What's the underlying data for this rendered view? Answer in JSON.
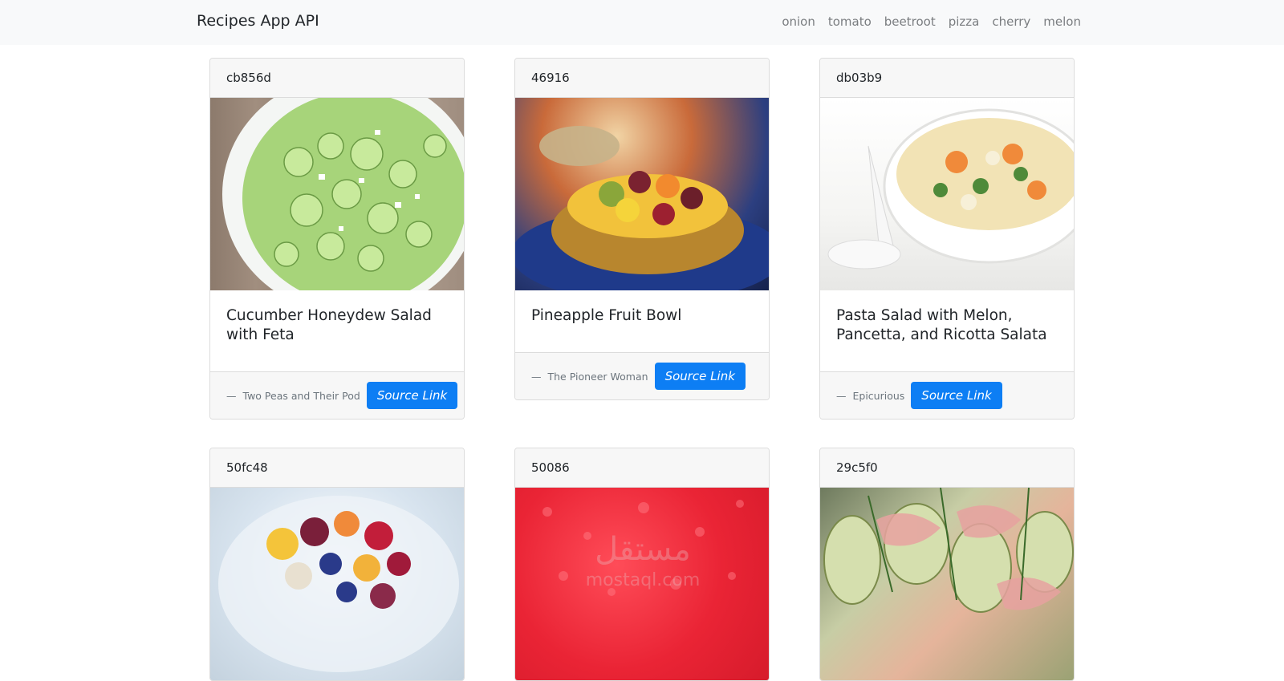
{
  "navbar": {
    "brand": "Recipes App API",
    "links": [
      "onion",
      "tomato",
      "beetroot",
      "pizza",
      "cherry",
      "melon"
    ]
  },
  "cards": [
    {
      "id": "cb856d",
      "title": "Cucumber Honeydew Salad with Feta",
      "source": "Two Peas and Their Pod",
      "button": "Source Link"
    },
    {
      "id": "46916",
      "title": "Pineapple Fruit Bowl",
      "source": "The Pioneer Woman",
      "button": "Source Link"
    },
    {
      "id": "db03b9",
      "title": "Pasta Salad with Melon, Pancetta, and Ricotta Salata",
      "source": "Epicurious",
      "button": "Source Link"
    },
    {
      "id": "50fc48"
    },
    {
      "id": "50086",
      "watermark": "مستقل mostaql.com"
    },
    {
      "id": "29c5f0"
    }
  ],
  "footer_dash": "—",
  "colors": {
    "navbar_bg": "#f8f9fa",
    "button_bg": "#0d7ef4",
    "card_header_bg": "#f7f7f7"
  }
}
